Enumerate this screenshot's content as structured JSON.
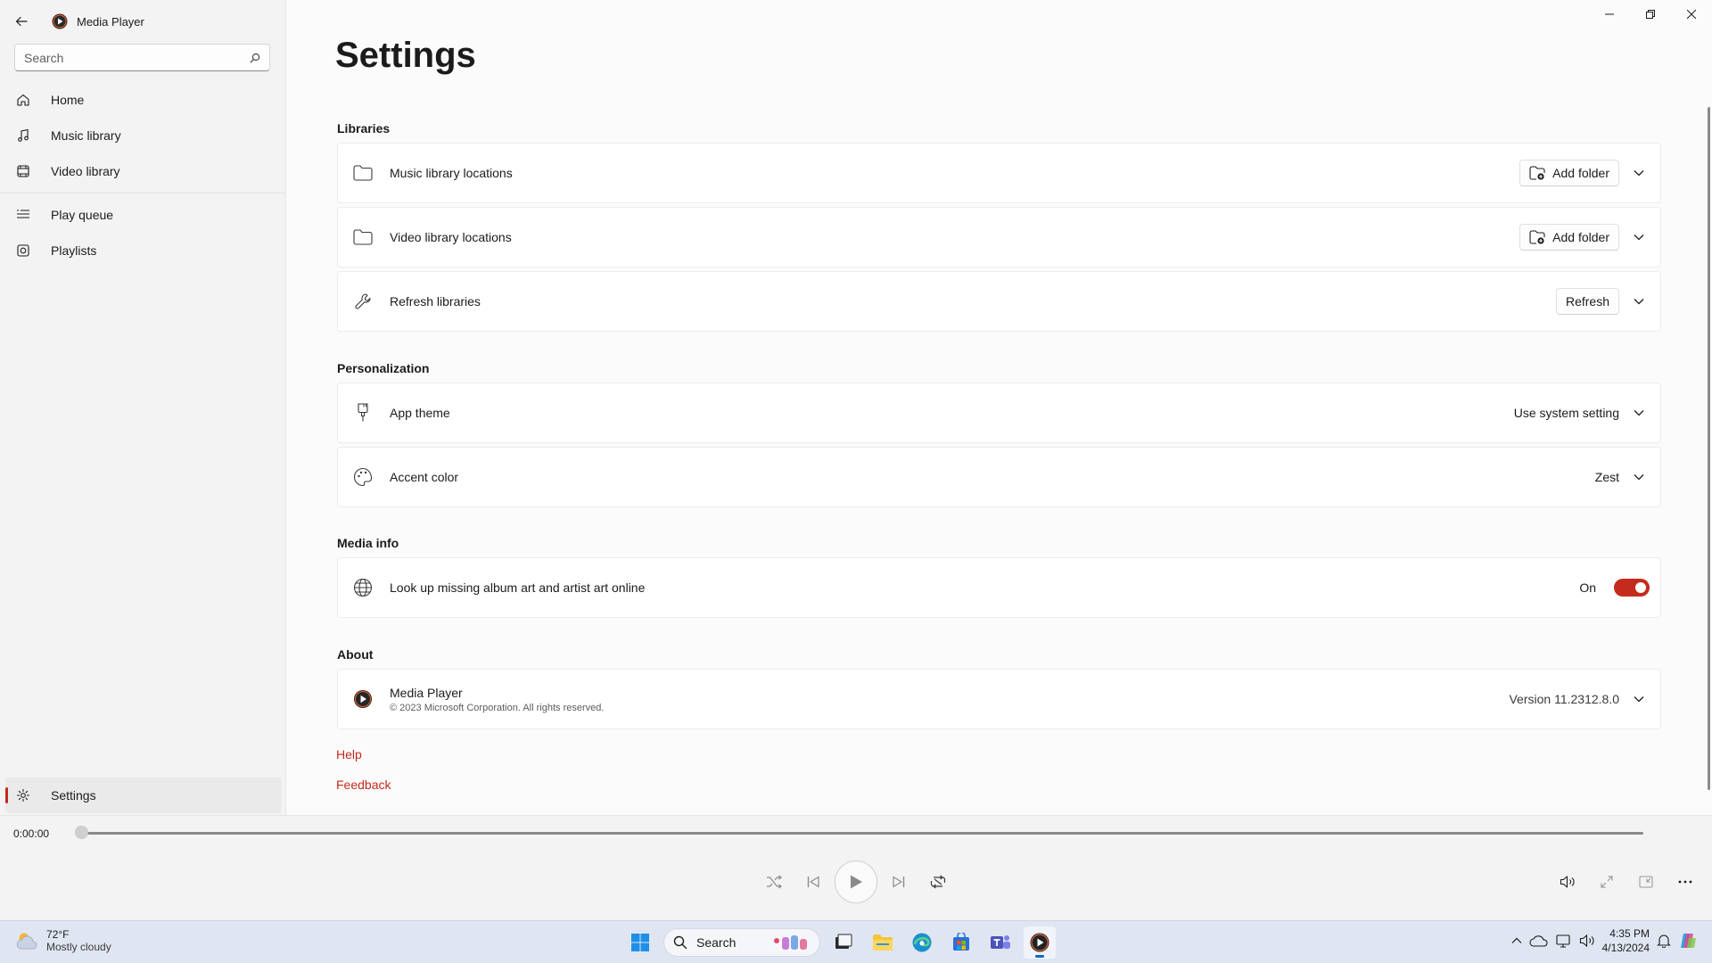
{
  "app": {
    "title": "Media Player"
  },
  "sidebar": {
    "search_placeholder": "Search",
    "items": [
      {
        "label": "Home",
        "icon": "home-icon"
      },
      {
        "label": "Music library",
        "icon": "music-note-icon"
      },
      {
        "label": "Video library",
        "icon": "video-icon"
      },
      {
        "label": "Play queue",
        "icon": "queue-icon"
      },
      {
        "label": "Playlists",
        "icon": "playlist-icon"
      }
    ],
    "settings_label": "Settings"
  },
  "page": {
    "title": "Settings"
  },
  "sections": {
    "libraries": {
      "title": "Libraries",
      "music_label": "Music library locations",
      "video_label": "Video library locations",
      "refresh_label": "Refresh libraries",
      "add_folder_label": "Add folder",
      "refresh_button": "Refresh"
    },
    "personalization": {
      "title": "Personalization",
      "theme_label": "App theme",
      "theme_value": "Use system setting",
      "accent_label": "Accent color",
      "accent_value": "Zest"
    },
    "media_info": {
      "title": "Media info",
      "lookup_label": "Look up missing album art and artist art online",
      "lookup_state": "On"
    },
    "about": {
      "title": "About",
      "app_name": "Media Player",
      "copyright": "© 2023 Microsoft Corporation. All rights reserved.",
      "version": "Version 11.2312.8.0"
    }
  },
  "links": {
    "help": "Help",
    "feedback": "Feedback"
  },
  "player": {
    "time": "0:00:00"
  },
  "taskbar": {
    "weather_temp": "72°F",
    "weather_desc": "Mostly cloudy",
    "search_label": "Search",
    "time": "4:35 PM",
    "date": "4/13/2024"
  },
  "colors": {
    "accent": "#c42b1c",
    "taskbar": "#dfe6f2"
  }
}
